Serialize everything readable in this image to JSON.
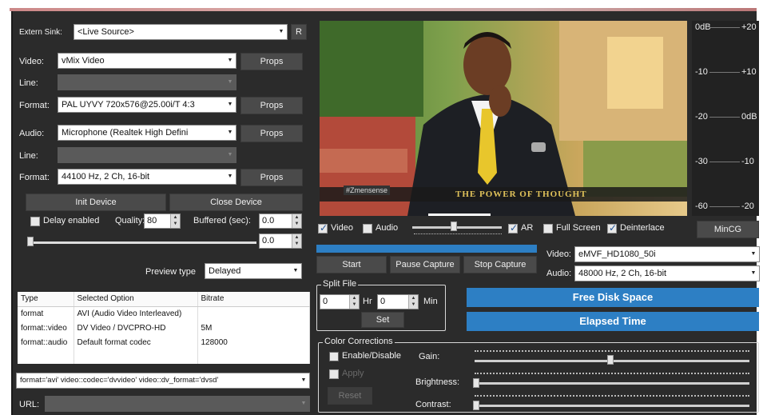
{
  "source": {
    "external_sink_label": "Extern Sink:",
    "external_sink_value": "<Live Source>",
    "refresh_button": "R"
  },
  "video": {
    "video_label": "Video:",
    "video_device": "vMix Video",
    "props1": "Props",
    "line_label": "Line:",
    "line_value": "",
    "format_label": "Format:",
    "format_value": "PAL UYVY 720x576@25.00i/T 4:3",
    "props2": "Props"
  },
  "audio": {
    "audio_label": "Audio:",
    "audio_device": "Microphone (Realtek High Defini",
    "props3": "Props",
    "line_label": "Line:",
    "line_value": "",
    "format_label": "Format:",
    "format_value": "44100 Hz, 2 Ch, 16-bit",
    "props4": "Props"
  },
  "device": {
    "init_button": "Init Device",
    "close_button": "Close Device"
  },
  "delay": {
    "delay_enabled_label": "Delay enabled",
    "quality_label": "Quality:",
    "quality_value": "80",
    "buffered_label": "Buffered (sec):",
    "buffered_value": "0.0",
    "buffered_value2": "0.0",
    "preview_type_label": "Preview type",
    "preview_type_value": "Delayed"
  },
  "options_table": {
    "headers": [
      "Type",
      "Selected Option",
      "Bitrate"
    ],
    "rows": [
      [
        "format",
        "AVI (Audio Video Interleaved)",
        ""
      ],
      [
        "format::video",
        "DV Video / DVCPRO-HD",
        "5M"
      ],
      [
        "format::audio",
        "Default format codec",
        "128000"
      ]
    ]
  },
  "command_line": "format='avi' video::codec='dvvideo' video::dv_format='dvsd'",
  "url": {
    "label": "URL:",
    "value": ""
  },
  "preview": {
    "lower_third_tag": "#Zmensense",
    "lower_third_title": "THE POWER OF THOUGHT"
  },
  "preview_options": {
    "video_label": "Video",
    "audio_label": "Audio",
    "ar_label": "AR",
    "fullscreen_label": "Full Screen",
    "deinterlace_label": "Deinterlace"
  },
  "capture": {
    "start_button": "Start",
    "pause_button": "Pause Capture",
    "stop_button": "Stop Capture",
    "video_label": "Video:",
    "video_device": "eMVF_HD1080_50i",
    "audio_label": "Audio:",
    "audio_format": "48000 Hz, 2 Ch, 16-bit"
  },
  "split_file": {
    "title": "Split File",
    "hours_value": "0",
    "hours_label": "Hr",
    "minutes_value": "0",
    "minutes_label": "Min",
    "set_button": "Set"
  },
  "status": {
    "free_disk_space": "Free Disk Space",
    "elapsed_time": "Elapsed Time"
  },
  "color_corrections": {
    "title": "Color Corrections",
    "enable_label": "Enable/Disable",
    "apply_label": "Apply",
    "reset_button": "Reset",
    "gain_label": "Gain:",
    "brightness_label": "Brightness:",
    "contrast_label": "Contrast:"
  },
  "vu_meter": {
    "top_left": "0dB",
    "top_right": "+20",
    "r1_left": "-10",
    "r1_right": "+10",
    "r2_left": "-20",
    "r2_right": "0dB",
    "r3_left": "-30",
    "r3_right": "-10",
    "r4_left": "-60",
    "r4_right": "-20",
    "mincg_button": "MinCG"
  },
  "colors": {
    "panel_bg": "#2b2b2b",
    "accent_blue": "#2d7fc4",
    "lower_third_gold": "#d9b84a"
  }
}
